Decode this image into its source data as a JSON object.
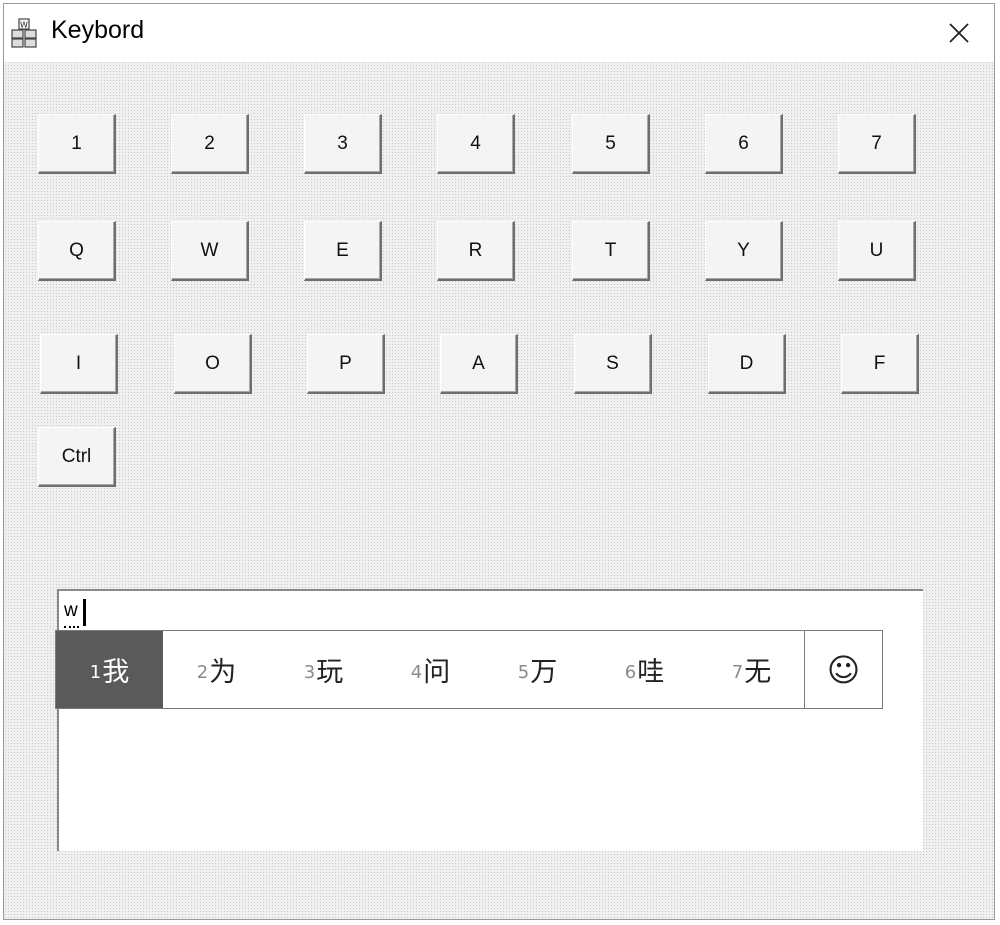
{
  "window": {
    "title": "Keybord",
    "app_icon": "keyboard-app-icon",
    "close_icon": "close-icon"
  },
  "keys": {
    "row1": [
      "1",
      "2",
      "3",
      "4",
      "5",
      "6",
      "7"
    ],
    "row2": [
      "Q",
      "W",
      "E",
      "R",
      "T",
      "Y",
      "U"
    ],
    "row3": [
      "I",
      "O",
      "P",
      "A",
      "S",
      "D",
      "F"
    ],
    "row4": [
      "Ctrl"
    ]
  },
  "text_area": {
    "composition": "w"
  },
  "ime": {
    "candidates": [
      {
        "num": "1",
        "char": "我"
      },
      {
        "num": "2",
        "char": "为"
      },
      {
        "num": "3",
        "char": "玩"
      },
      {
        "num": "4",
        "char": "问"
      },
      {
        "num": "5",
        "char": "万"
      },
      {
        "num": "6",
        "char": "哇"
      },
      {
        "num": "7",
        "char": "无"
      }
    ],
    "selected_index": 0,
    "emoji_icon": "smiley-icon",
    "emoji_glyph": "☺"
  }
}
